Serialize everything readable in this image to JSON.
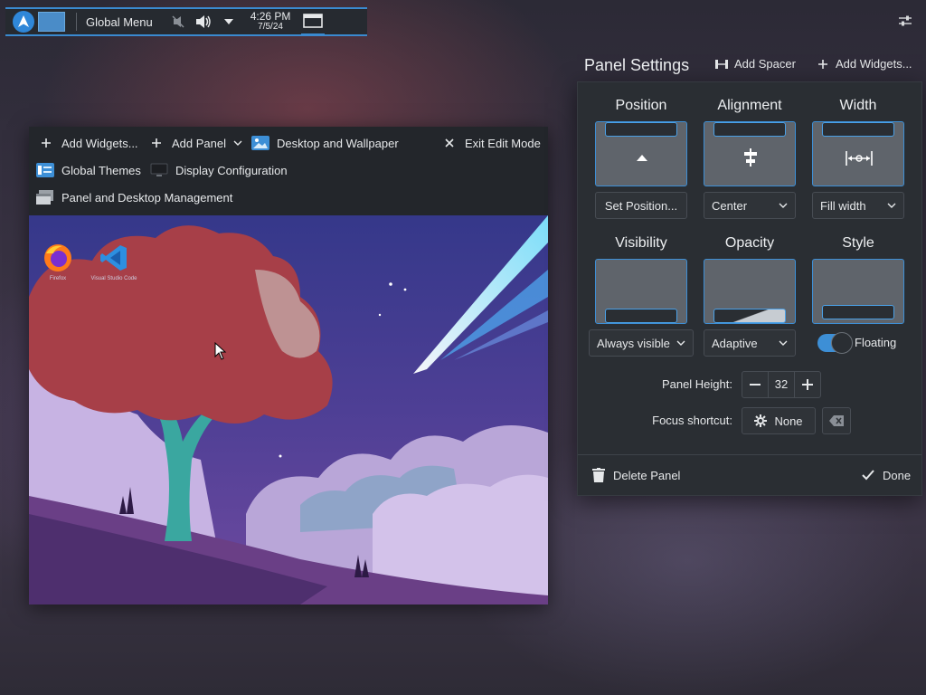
{
  "top_panel": {
    "global_menu": "Global Menu",
    "time": "4:26 PM",
    "date": "7/5/24"
  },
  "toolbar": {
    "add_widgets": "Add Widgets...",
    "add_panel": "Add Panel",
    "desktop_wallpaper": "Desktop and Wallpaper",
    "exit_edit_mode": "Exit Edit Mode",
    "global_themes": "Global Themes",
    "display_configuration": "Display Configuration",
    "panel_desktop_management": "Panel and Desktop Management"
  },
  "desktop_icons": [
    {
      "label": "Firefox",
      "icon": "firefox-icon"
    },
    {
      "label": "Visual Studio Code",
      "icon": "vscode-icon"
    }
  ],
  "panel_settings": {
    "title": "Panel Settings",
    "add_spacer": "Add Spacer",
    "add_widgets": "Add Widgets...",
    "position": {
      "label": "Position",
      "button": "Set Position..."
    },
    "alignment": {
      "label": "Alignment",
      "value": "Center"
    },
    "width": {
      "label": "Width",
      "value": "Fill width"
    },
    "visibility": {
      "label": "Visibility",
      "value": "Always visible"
    },
    "opacity": {
      "label": "Opacity",
      "value": "Adaptive"
    },
    "style": {
      "label": "Style",
      "value": "Floating",
      "enabled": true
    },
    "panel_height": {
      "label": "Panel Height:",
      "value": "32"
    },
    "focus_shortcut": {
      "label": "Focus shortcut:",
      "value": "None"
    },
    "delete_panel": "Delete Panel",
    "done": "Done"
  },
  "colors": {
    "accent": "#3d8fd6",
    "panel_bg": "#2a2e33",
    "tile_bg": "#5f646b"
  }
}
